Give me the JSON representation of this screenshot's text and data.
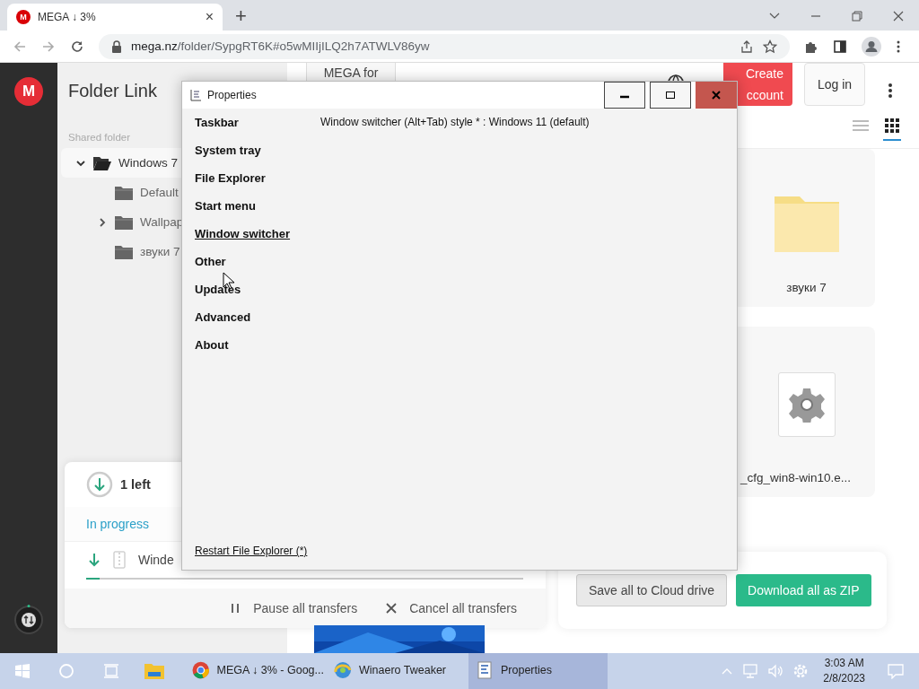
{
  "browser": {
    "tab": {
      "favicon_letter": "M",
      "title": "MEGA ↓ 3%",
      "close": "×"
    },
    "new_tab": "+",
    "url": {
      "host": "mega.nz",
      "path": "/folder/SypgRT6K#o5wMIIjILQ2h7ATWLV86yw"
    }
  },
  "mega": {
    "logo_letter": "M",
    "title": "Folder Link",
    "section_label": "Shared folder",
    "tree": [
      {
        "name": "Windows 7",
        "selected": true,
        "expanded": true,
        "children": [
          {
            "name": "Default",
            "selected": false
          },
          {
            "name": "Wallpap",
            "selected": false,
            "expanded": false
          },
          {
            "name": "звуки 7",
            "selected": false
          }
        ]
      }
    ],
    "header": {
      "mega_for": "MEGA for",
      "create_account": [
        "Create",
        "ccount"
      ],
      "login": "Log in"
    },
    "view_modes": [
      {
        "kind": "list",
        "selected": false
      },
      {
        "kind": "grid",
        "selected": true
      }
    ],
    "items": [
      {
        "kind": "folder",
        "name": "звуки 7"
      },
      {
        "kind": "file",
        "name": "_cfg_win8-win10.e..."
      }
    ],
    "transfers": {
      "remaining": "1 left",
      "tabs": [
        {
          "label": "In progress",
          "selected": true
        }
      ],
      "rows": [
        {
          "name": "Winde",
          "level": 0.03
        }
      ],
      "actions": [
        {
          "kind": "pause",
          "label": "Pause all transfers"
        },
        {
          "kind": "cancel",
          "label": "Cancel all transfers"
        }
      ]
    },
    "footer_buttons": [
      {
        "kind": "secondary",
        "label": "Save all to Cloud drive"
      },
      {
        "kind": "primary",
        "label": "Download all as ZIP"
      }
    ]
  },
  "dialog": {
    "title": "Properties",
    "nav": [
      {
        "label": "Taskbar",
        "selected": false
      },
      {
        "label": "System tray",
        "selected": false
      },
      {
        "label": "File Explorer",
        "selected": false
      },
      {
        "label": "Start menu",
        "selected": false
      },
      {
        "label": "Window switcher",
        "selected": true
      },
      {
        "label": "Other",
        "selected": false
      },
      {
        "label": "Updates",
        "selected": false
      },
      {
        "label": "Advanced",
        "selected": false
      },
      {
        "label": "About",
        "selected": false
      }
    ],
    "setting": "Window switcher (Alt+Tab) style * : Windows 11 (default)",
    "footer_link": "Restart File Explorer (*)"
  },
  "taskbar": {
    "apps": [
      {
        "kind": "chrome",
        "label": "MEGA ↓ 3% - Goog...",
        "selected": false
      },
      {
        "kind": "winaero",
        "label": "Winaero Tweaker",
        "selected": false
      },
      {
        "kind": "properties",
        "label": "Properties",
        "selected": true
      }
    ],
    "time": "3:03 AM",
    "date": "2/8/2023"
  }
}
